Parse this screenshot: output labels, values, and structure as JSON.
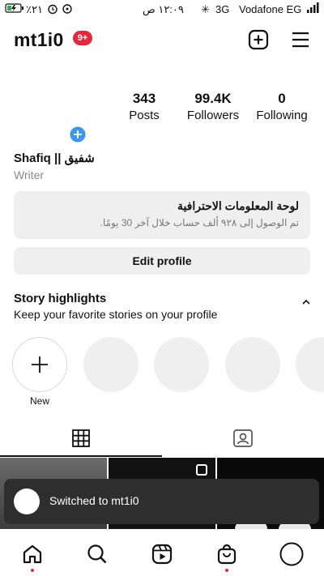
{
  "status_bar": {
    "left": "٪٢١",
    "time": "١٢:٠٩ ص",
    "network": "3G",
    "carrier": "Vodafone EG"
  },
  "header": {
    "username": "mt1i0",
    "notification_badge": "9+"
  },
  "stats": [
    {
      "value": "343",
      "label": "Posts"
    },
    {
      "value": "99.4K",
      "label": "Followers"
    },
    {
      "value": "0",
      "label": "Following"
    }
  ],
  "profile": {
    "name": "Shafiq || شفيق",
    "bio": "Writer"
  },
  "professional_dashboard": {
    "title": "لوحة المعلومات الاحترافية",
    "subtitle": "تم الوصول إلى ٩٢٨ ألف حساب خلال آخر 30 يومًا."
  },
  "edit_profile_label": "Edit profile",
  "highlights": {
    "title": "Story highlights",
    "subtitle": "Keep your favorite stories on your profile",
    "new_label": "New"
  },
  "toast": {
    "text": "Switched to mt1i0"
  },
  "colors": {
    "badge": "#e6283d",
    "accent_blue": "#3897f0",
    "toast_bg": "#2e2e2e"
  },
  "icons": {
    "create": "plus-square-icon",
    "menu": "hamburger-icon",
    "grid": "grid-icon",
    "tagged": "tagged-icon",
    "nav": [
      "home-icon",
      "search-icon",
      "reels-icon",
      "shop-icon",
      "profile-icon"
    ]
  }
}
